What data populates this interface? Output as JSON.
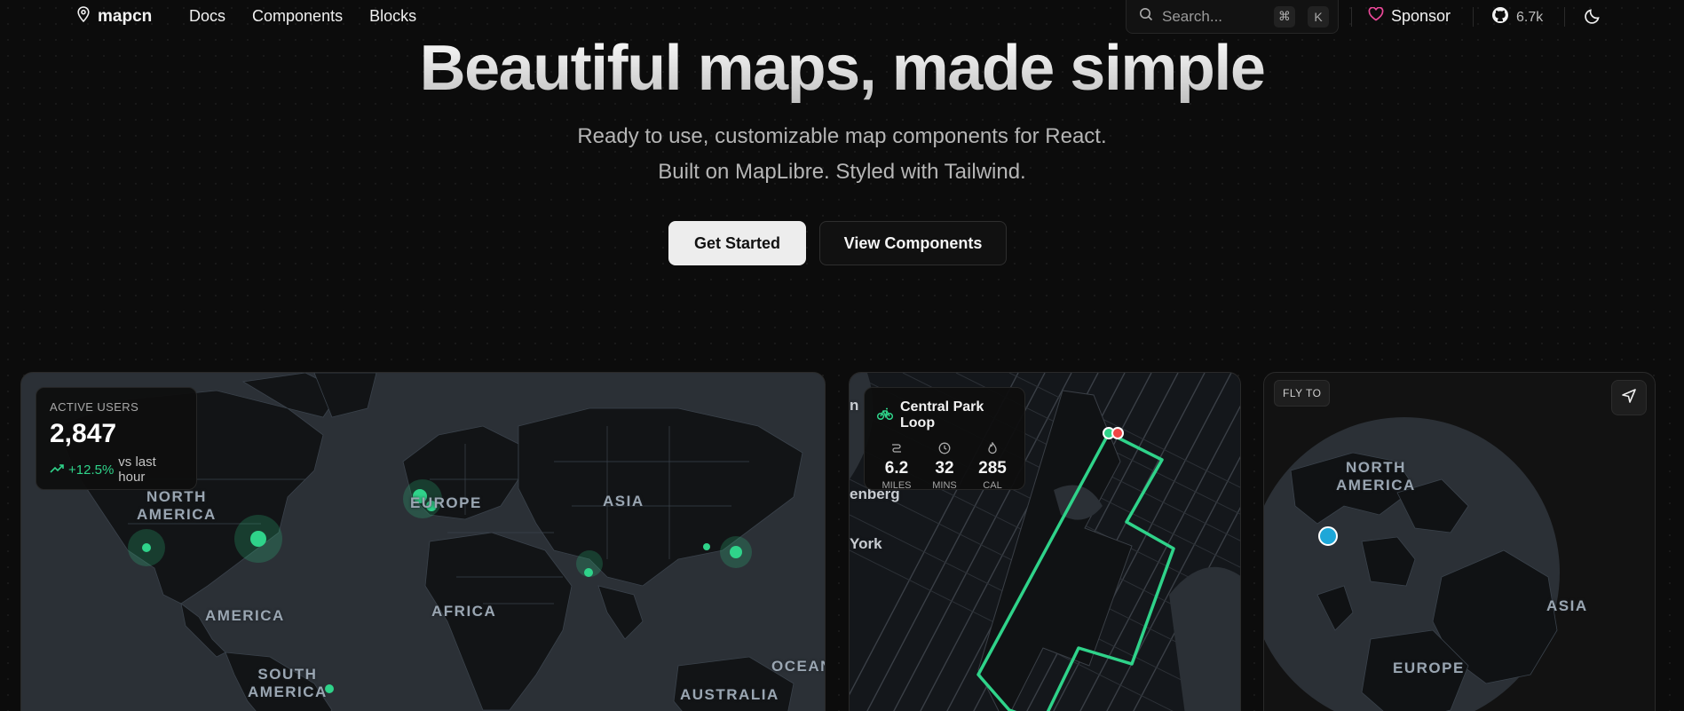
{
  "nav": {
    "brand": "mapcn",
    "links": [
      "Docs",
      "Components",
      "Blocks"
    ],
    "search_placeholder": "Search...",
    "shortcut": [
      "⌘",
      "K"
    ],
    "sponsor": "Sponsor",
    "github_stars": "6.7k"
  },
  "hero": {
    "title": "Beautiful maps, made simple",
    "subtitle_line1": "Ready to use, customizable map components for React.",
    "subtitle_line2": "Built on MapLibre. Styled with Tailwind.",
    "primary_button": "Get Started",
    "secondary_button": "View Components"
  },
  "users_card": {
    "label": "ACTIVE USERS",
    "value": "2,847",
    "change": "+12.5%",
    "change_suffix": "vs last hour",
    "map_labels": {
      "north_america": "NORTH\nAMERICA",
      "europe": "EUROPE",
      "asia": "ASIA",
      "america": "AMERICA",
      "africa": "AFRICA",
      "south_america": "SOUTH\nAMERICA",
      "ocean": "OCEAN",
      "australia": "AUSTRALIA"
    }
  },
  "route_card": {
    "title": "Central Park Loop",
    "stats": [
      {
        "value": "6.2",
        "unit": "MILES"
      },
      {
        "value": "32",
        "unit": "MINS"
      },
      {
        "value": "285",
        "unit": "CAL"
      }
    ],
    "map_labels": {
      "n": "n",
      "enberg": "enberg",
      "york": "York"
    }
  },
  "globe_card": {
    "label": "FLY TO",
    "map_labels": {
      "north_america": "NORTH\nAMERICA",
      "asia": "ASIA",
      "europe": "EUROPE"
    }
  },
  "colors": {
    "accent": "#2fd38a",
    "route_end": "#ef4444",
    "fly_marker": "#1ea7d8",
    "sponsor_heart": "#ec4899"
  }
}
